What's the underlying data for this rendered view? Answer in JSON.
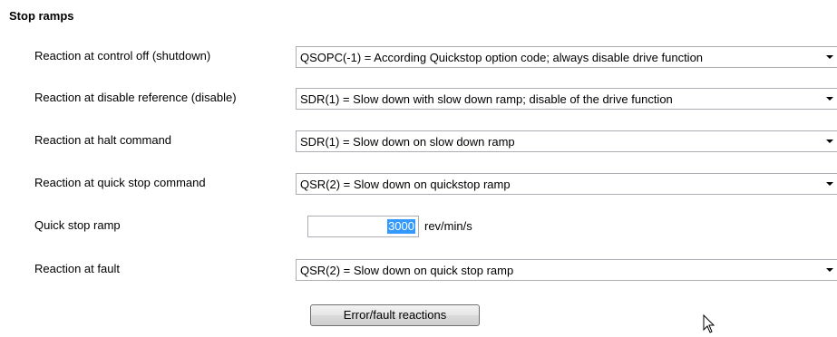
{
  "section": {
    "title": "Stop ramps"
  },
  "rows": [
    {
      "label": "Reaction at control off (shutdown)",
      "value": "QSOPC(-1) = According Quickstop option code; always disable drive function"
    },
    {
      "label": "Reaction at disable reference (disable)",
      "value": "SDR(1) = Slow down with slow down ramp; disable of the drive function"
    },
    {
      "label": "Reaction at halt command",
      "value": "SDR(1) = Slow down on slow down ramp"
    },
    {
      "label": "Reaction at quick stop command",
      "value": "QSR(2) = Slow down on quickstop ramp"
    },
    {
      "label": "Quick stop ramp",
      "value": "3000",
      "unit": "rev/min/s"
    },
    {
      "label": "Reaction at fault",
      "value": "QSR(2) = Slow down on quick stop ramp"
    }
  ],
  "button": {
    "label": "Error/fault reactions"
  },
  "icons": {
    "dropdown": "chevron-down-icon",
    "cursor": "mouse-pointer-icon"
  },
  "colors": {
    "selection": "#3399ff",
    "border": "#abadb3"
  }
}
